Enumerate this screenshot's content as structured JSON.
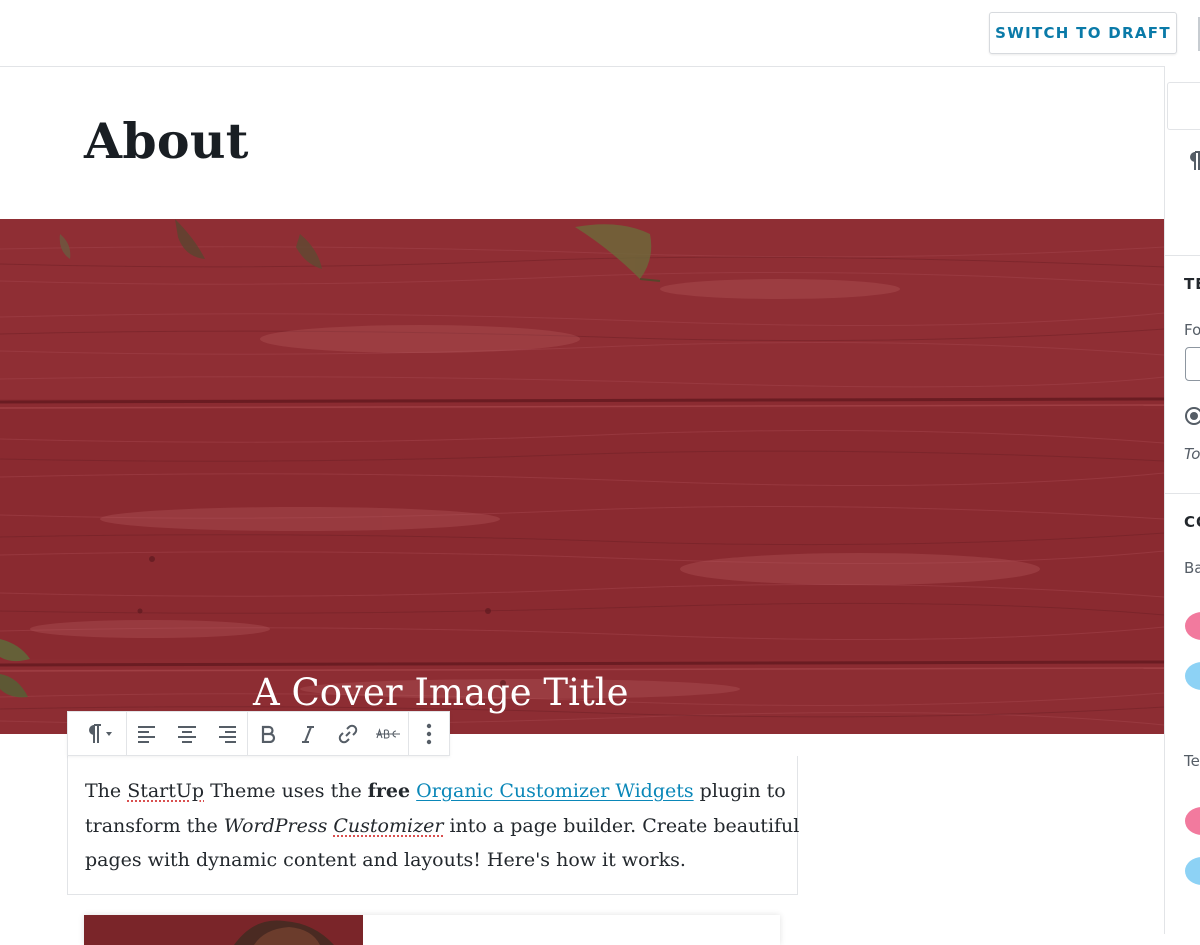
{
  "topbar": {
    "switch_to_draft_label": "SWITCH TO DRAFT"
  },
  "editor": {
    "page_title": "About",
    "cover": {
      "title": "A Cover Image Title",
      "overlay_color": "#8a2a30"
    },
    "toolbar": {
      "paragraph_icon": "paragraph-icon",
      "buttons": [
        "align-left-icon",
        "align-center-icon",
        "align-right-icon",
        "bold-icon",
        "italic-icon",
        "link-icon",
        "strikethrough-icon",
        "more-options-icon"
      ]
    },
    "paragraph": {
      "seg1": "The ",
      "seg2_spell": "StartUp",
      "seg3": " Theme uses the ",
      "seg4_bold": "free",
      "seg5": " ",
      "seg6_link": "Organic Customizer Widgets",
      "seg7": " plugin to",
      "seg8": "transform the ",
      "seg9_italic": "WordPress ",
      "seg10_italic_spell": "Customizer",
      "seg11": " into a page builder. Create beautiful",
      "seg12": "pages with dynamic content and layouts! Here's how it works."
    }
  },
  "sidebar": {
    "text_settings_heading": "TE",
    "font_size_label": "Fo",
    "toggle_help": "To",
    "color_settings_heading": "CO",
    "background_label": "Ba",
    "text_color_label": "Te",
    "swatch_colors": {
      "pink": "#f27a9e",
      "blue": "#8dd2f5"
    }
  },
  "colors": {
    "accent": "#0a7aa8",
    "link": "#0a87b8",
    "heading": "#191e23"
  }
}
